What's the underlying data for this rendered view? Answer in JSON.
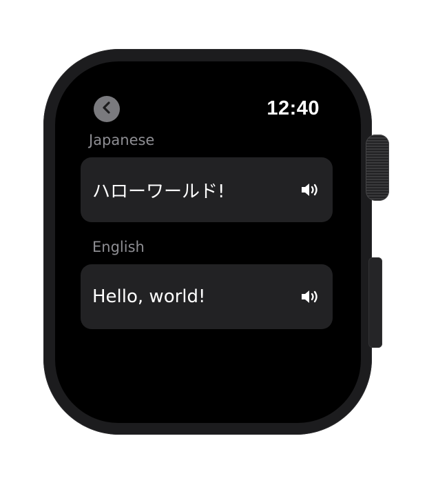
{
  "status_bar": {
    "time": "12:40"
  },
  "navigation": {
    "back_icon": "chevron-left-icon"
  },
  "translations": [
    {
      "language": "Japanese",
      "text": "ハローワールド!",
      "action_icon": "speaker-icon"
    },
    {
      "language": "English",
      "text": "Hello, world!",
      "action_icon": "speaker-icon"
    }
  ],
  "colors": {
    "background": "#000000",
    "card": "#222224",
    "label": "#8e8e93",
    "text": "#ffffff",
    "back_button": "#7a7a7e"
  }
}
